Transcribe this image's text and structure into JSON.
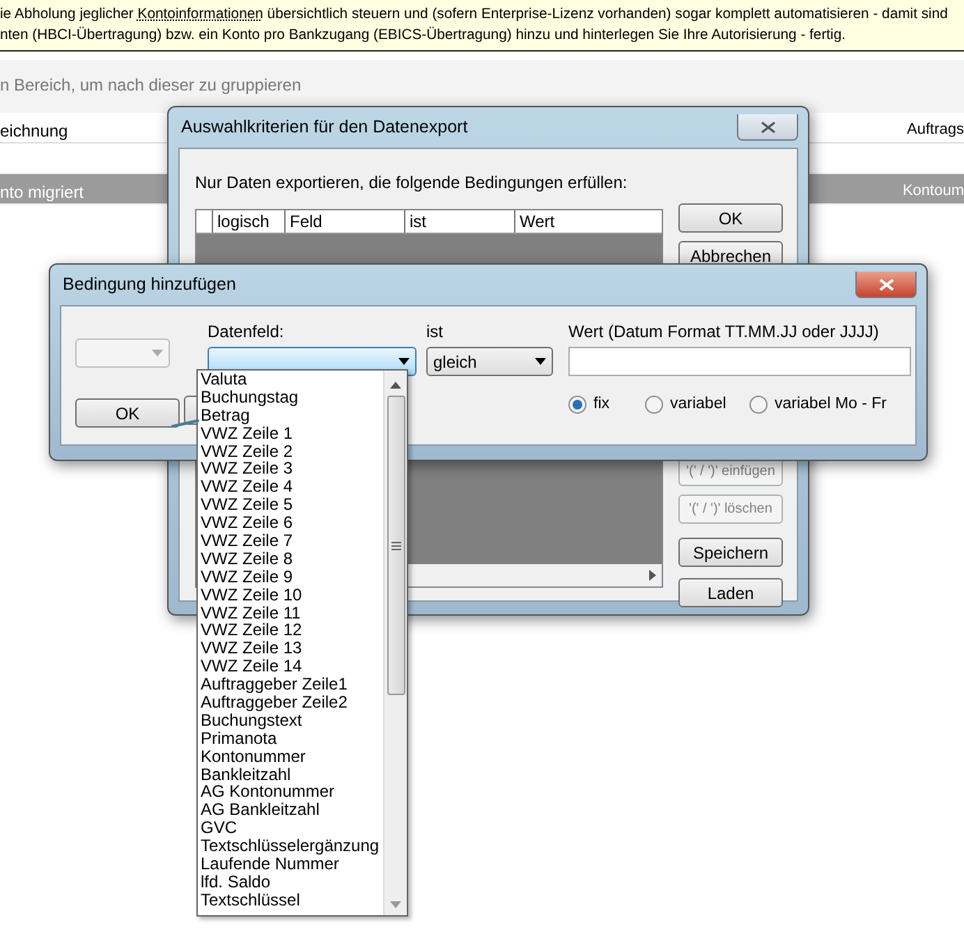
{
  "info_bar": {
    "line1_before": "ie Abholung jeglicher",
    "line1_link": "Kontoinformationen",
    "line1_after": "übersichtlich steuern und (sofern Enterprise-Lizenz vorhanden) sogar komplett automatisieren - damit sind",
    "line2": "nten (HBCI-Übertragung) bzw. ein Konto pro Bankzugang (EBICS-Übertragung) hinzu und hinterlegen Sie Ihre Autorisierung - fertig."
  },
  "group_hint": "n Bereich, um nach dieser zu gruppieren",
  "table": {
    "columns": [
      "eichnung",
      "Auftrags"
    ],
    "rows": [
      {
        "cells": [
          "nto migriert",
          "Kontoum"
        ],
        "selected": true
      }
    ]
  },
  "export_dialog": {
    "title": "Auswahlkriterien für den Datenexport",
    "instruction": "Nur Daten exportieren, die folgende Bedingungen erfüllen:",
    "grid_columns": [
      "logisch",
      "Feld",
      "ist",
      "Wert"
    ],
    "buttons": [
      {
        "label": "OK",
        "disabled": false
      },
      {
        "label": "Abbrechen",
        "disabled": false
      },
      {
        "label": "'(' / ')' einfügen",
        "disabled": true
      },
      {
        "label": "'(' / ')' löschen",
        "disabled": true
      },
      {
        "label": "Speichern",
        "disabled": false
      },
      {
        "label": "Laden",
        "disabled": false
      }
    ]
  },
  "condition_dialog": {
    "title": "Bedingung hinzufügen",
    "logic_combo": {
      "disabled": true
    },
    "field_label": "Datenfeld:",
    "field_combo": {
      "expanded": true
    },
    "operator_label": "ist",
    "operator_value": "gleich",
    "value_label": "Wert (Datum Format TT.MM.JJ oder JJJJ)",
    "radios": [
      {
        "label": "fix",
        "selected": true
      },
      {
        "label": "variabel",
        "selected": false
      },
      {
        "label": "variabel Mo - Fr",
        "selected": false
      }
    ],
    "ok_label": "OK",
    "field_options": [
      "Valuta",
      "Buchungstag",
      "Betrag",
      "VWZ Zeile 1",
      "VWZ Zeile 2",
      "VWZ Zeile 3",
      "VWZ Zeile 4",
      "VWZ Zeile 5",
      "VWZ Zeile 6",
      "VWZ Zeile 7",
      "VWZ Zeile 8",
      "VWZ Zeile 9",
      "VWZ Zeile 10",
      "VWZ Zeile 11",
      "VWZ Zeile 12",
      "VWZ Zeile 13",
      "VWZ Zeile 14",
      "Auftraggeber Zeile1",
      "Auftraggeber Zeile2",
      "Buchungstext",
      "Primanota",
      "Kontonummer",
      "Bankleitzahl",
      "AG Kontonummer",
      "AG Bankleitzahl",
      "GVC",
      "Textschlüsselergänzung",
      "Laufende Nummer",
      "lfd. Saldo",
      "Textschlüssel"
    ]
  }
}
